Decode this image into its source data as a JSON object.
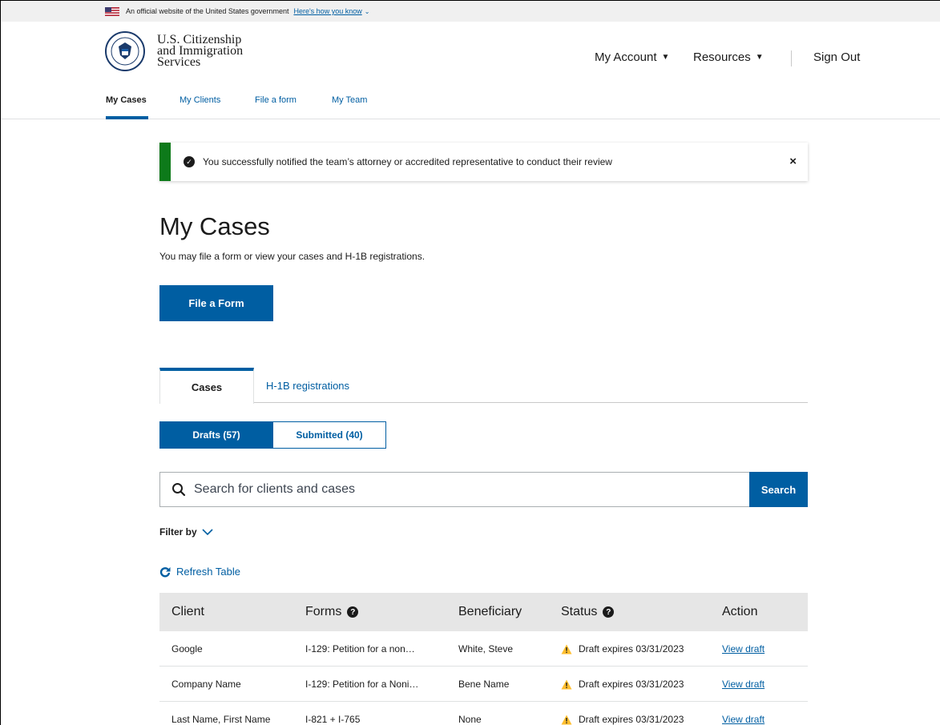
{
  "gov_banner": {
    "text": "An official website of the United States government",
    "link": "Here's how you know"
  },
  "header": {
    "agency_line1": "U.S. Citizenship",
    "agency_line2": "and Immigration",
    "agency_line3": "Services",
    "nav": {
      "my_account": "My Account",
      "resources": "Resources",
      "sign_out": "Sign Out"
    },
    "subnav": [
      "My Cases",
      "My Clients",
      "File a form",
      "My Team"
    ]
  },
  "alert": {
    "message": "You successfully notified the team’s attorney or accredited representative to conduct their review",
    "close": "×"
  },
  "main": {
    "title": "My Cases",
    "subtitle": "You may file a form or view your cases and H-1B registrations.",
    "file_button": "File a Form",
    "tabs": [
      "Cases",
      "H-1B registrations"
    ],
    "segments": [
      "Drafts (57)",
      "Submitted (40)"
    ],
    "search": {
      "placeholder": "Search for clients and cases",
      "button": "Search"
    },
    "filter_label": "Filter by",
    "refresh_label": "Refresh Table"
  },
  "table": {
    "headers": [
      "Client",
      "Forms",
      "Beneficiary",
      "Status",
      "Action"
    ],
    "rows": [
      {
        "client": "Google",
        "forms": "I-129: Petition for a non…",
        "beneficiary": "White, Steve",
        "status": "Draft expires 03/31/2023",
        "action": "View draft"
      },
      {
        "client": "Company Name",
        "forms": "I-129: Petition for a Noni…",
        "beneficiary": "Bene Name",
        "status": "Draft expires 03/31/2023",
        "action": "View draft"
      },
      {
        "client": "Last Name, First Name",
        "forms": "I-821 + I-765",
        "beneficiary": "None",
        "status": "Draft expires 03/31/2023",
        "action": "View draft"
      }
    ]
  },
  "colors": {
    "primary": "#005ea2",
    "success": "#0d7a1a",
    "warning": "#ffbe2e",
    "header_bg": "#e6e6e6"
  }
}
